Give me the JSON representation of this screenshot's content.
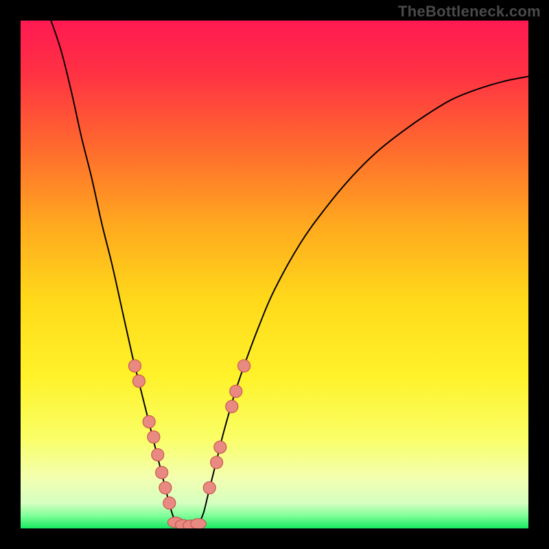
{
  "watermark": "TheBottleneck.com",
  "chart_data": {
    "type": "line",
    "title": "",
    "xlabel": "",
    "ylabel": "",
    "xlim": [
      0,
      100
    ],
    "ylim": [
      0,
      100
    ],
    "grid": false,
    "legend": false,
    "background_gradient": {
      "stops": [
        {
          "offset": 0.0,
          "color": "#ff1a52"
        },
        {
          "offset": 0.1,
          "color": "#ff3044"
        },
        {
          "offset": 0.25,
          "color": "#ff6a2e"
        },
        {
          "offset": 0.4,
          "color": "#ffa81f"
        },
        {
          "offset": 0.55,
          "color": "#ffd91a"
        },
        {
          "offset": 0.7,
          "color": "#fff22a"
        },
        {
          "offset": 0.82,
          "color": "#faff65"
        },
        {
          "offset": 0.9,
          "color": "#f3ffb0"
        },
        {
          "offset": 0.95,
          "color": "#d6ffc0"
        },
        {
          "offset": 0.975,
          "color": "#80ff99"
        },
        {
          "offset": 1.0,
          "color": "#17e860"
        }
      ]
    },
    "series": [
      {
        "name": "bottleneck-curve-left",
        "type": "line",
        "stroke": "#000000",
        "stroke_width": 2,
        "points": [
          {
            "x": 6,
            "y": 100
          },
          {
            "x": 8,
            "y": 94
          },
          {
            "x": 10,
            "y": 86
          },
          {
            "x": 12,
            "y": 77
          },
          {
            "x": 14,
            "y": 69
          },
          {
            "x": 16,
            "y": 60
          },
          {
            "x": 18,
            "y": 52
          },
          {
            "x": 20,
            "y": 43
          },
          {
            "x": 22,
            "y": 34
          },
          {
            "x": 23,
            "y": 30
          },
          {
            "x": 24,
            "y": 26
          },
          {
            "x": 25,
            "y": 22
          },
          {
            "x": 26,
            "y": 18
          },
          {
            "x": 27,
            "y": 14
          },
          {
            "x": 28,
            "y": 10
          },
          {
            "x": 29,
            "y": 6
          },
          {
            "x": 30,
            "y": 2.5
          },
          {
            "x": 31,
            "y": 0.8
          }
        ]
      },
      {
        "name": "bottleneck-curve-bottom",
        "type": "line",
        "stroke": "#000000",
        "stroke_width": 2,
        "points": [
          {
            "x": 31,
            "y": 0.8
          },
          {
            "x": 32,
            "y": 0.5
          },
          {
            "x": 33,
            "y": 0.4
          },
          {
            "x": 34,
            "y": 0.5
          },
          {
            "x": 35,
            "y": 0.8
          }
        ]
      },
      {
        "name": "bottleneck-curve-right",
        "type": "line",
        "stroke": "#000000",
        "stroke_width": 2,
        "points": [
          {
            "x": 35,
            "y": 0.8
          },
          {
            "x": 36,
            "y": 3
          },
          {
            "x": 37,
            "y": 7
          },
          {
            "x": 38,
            "y": 11
          },
          {
            "x": 39,
            "y": 15
          },
          {
            "x": 40,
            "y": 19
          },
          {
            "x": 42,
            "y": 26
          },
          {
            "x": 44,
            "y": 32
          },
          {
            "x": 47,
            "y": 40
          },
          {
            "x": 50,
            "y": 47
          },
          {
            "x": 55,
            "y": 56
          },
          {
            "x": 60,
            "y": 63
          },
          {
            "x": 65,
            "y": 69
          },
          {
            "x": 70,
            "y": 74
          },
          {
            "x": 75,
            "y": 78
          },
          {
            "x": 80,
            "y": 81.5
          },
          {
            "x": 85,
            "y": 84.5
          },
          {
            "x": 90,
            "y": 86.5
          },
          {
            "x": 95,
            "y": 88
          },
          {
            "x": 100,
            "y": 89
          }
        ]
      },
      {
        "name": "left-branch-markers",
        "type": "scatter",
        "color": "#e98a82",
        "stroke": "#c9564f",
        "r": 9,
        "points": [
          {
            "x": 22.5,
            "y": 32
          },
          {
            "x": 23.3,
            "y": 29
          },
          {
            "x": 25.3,
            "y": 21
          },
          {
            "x": 26.2,
            "y": 18
          },
          {
            "x": 27.0,
            "y": 14.5
          },
          {
            "x": 27.8,
            "y": 11
          },
          {
            "x": 28.5,
            "y": 8
          },
          {
            "x": 29.3,
            "y": 5
          }
        ]
      },
      {
        "name": "right-branch-markers",
        "type": "scatter",
        "color": "#e98a82",
        "stroke": "#c9564f",
        "r": 9,
        "points": [
          {
            "x": 37.2,
            "y": 8
          },
          {
            "x": 38.6,
            "y": 13
          },
          {
            "x": 39.3,
            "y": 16
          },
          {
            "x": 41.6,
            "y": 24
          },
          {
            "x": 42.4,
            "y": 27
          },
          {
            "x": 44.0,
            "y": 32
          }
        ]
      },
      {
        "name": "bottom-cluster-markers",
        "type": "scatter",
        "shape": "pill",
        "color": "#e98a82",
        "stroke": "#c9564f",
        "r": 9,
        "points": [
          {
            "x": 30.5,
            "y": 1.2
          },
          {
            "x": 32.0,
            "y": 0.7
          },
          {
            "x": 33.5,
            "y": 0.6
          },
          {
            "x": 35.0,
            "y": 0.9
          }
        ]
      }
    ]
  }
}
